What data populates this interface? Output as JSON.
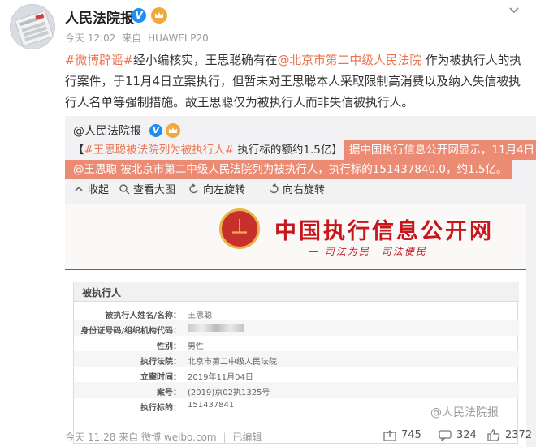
{
  "post": {
    "author": "人民法院报",
    "time": "今天 12:02",
    "from_label": "来自",
    "device": "HUAWEI P20",
    "text": {
      "tag": "#微博辟谣#",
      "part1": "经小编核实，王思聪确有在",
      "mention": "@北京市第二中级人民法院",
      "part2": " 作为被执行人的执行案件，于11月4日立案执行，但暂未对王思聪本人采取限制高消费以及纳入失信被执行人名单等强制措施。故王思聪仅为被执行人而非失信被执行人。"
    }
  },
  "repost": {
    "author": "@人民法院报",
    "line1_open": "【",
    "line1_tag": "#王思聪被法院列为被执行人#",
    "line1_text": " 执行标的额约1.5亿】",
    "line1_red": "据中国执行信息公开网显示，11月4日，",
    "line2_mention": "@王思聪",
    "line2_red": " 被北京市第二中级人民法院列为被执行人，执行标的151437840.0，约1.5亿。",
    "toolbar": {
      "collapse": "收起",
      "view_large": "查看大图",
      "rotate_left": "向左旋转",
      "rotate_right": "向右旋转"
    },
    "image": {
      "site_title": "中国执行信息公开网",
      "site_slogan": "— 司法为民　司法便民",
      "panel_title": "被执行人",
      "rows": [
        {
          "k": "被执行人姓名/名称：",
          "v": "王思聪"
        },
        {
          "k": "身份证号码/组织机构代码：",
          "v": ""
        },
        {
          "k": "性别：",
          "v": "男性"
        },
        {
          "k": "执行法院：",
          "v": "北京市第二中级人民法院"
        },
        {
          "k": "立案时间：",
          "v": "2019年11月04日"
        },
        {
          "k": "案号：",
          "v": "(2019)京02执1325号"
        },
        {
          "k": "执行标的：",
          "v": "151437841"
        }
      ],
      "watermark": "@人民法院报"
    }
  },
  "footer": {
    "time": "今天 11:28",
    "from_label": "来自",
    "source": "微博 weibo.com",
    "edit": "已编辑",
    "reposts": "745",
    "comments": "324",
    "likes": "2372"
  }
}
